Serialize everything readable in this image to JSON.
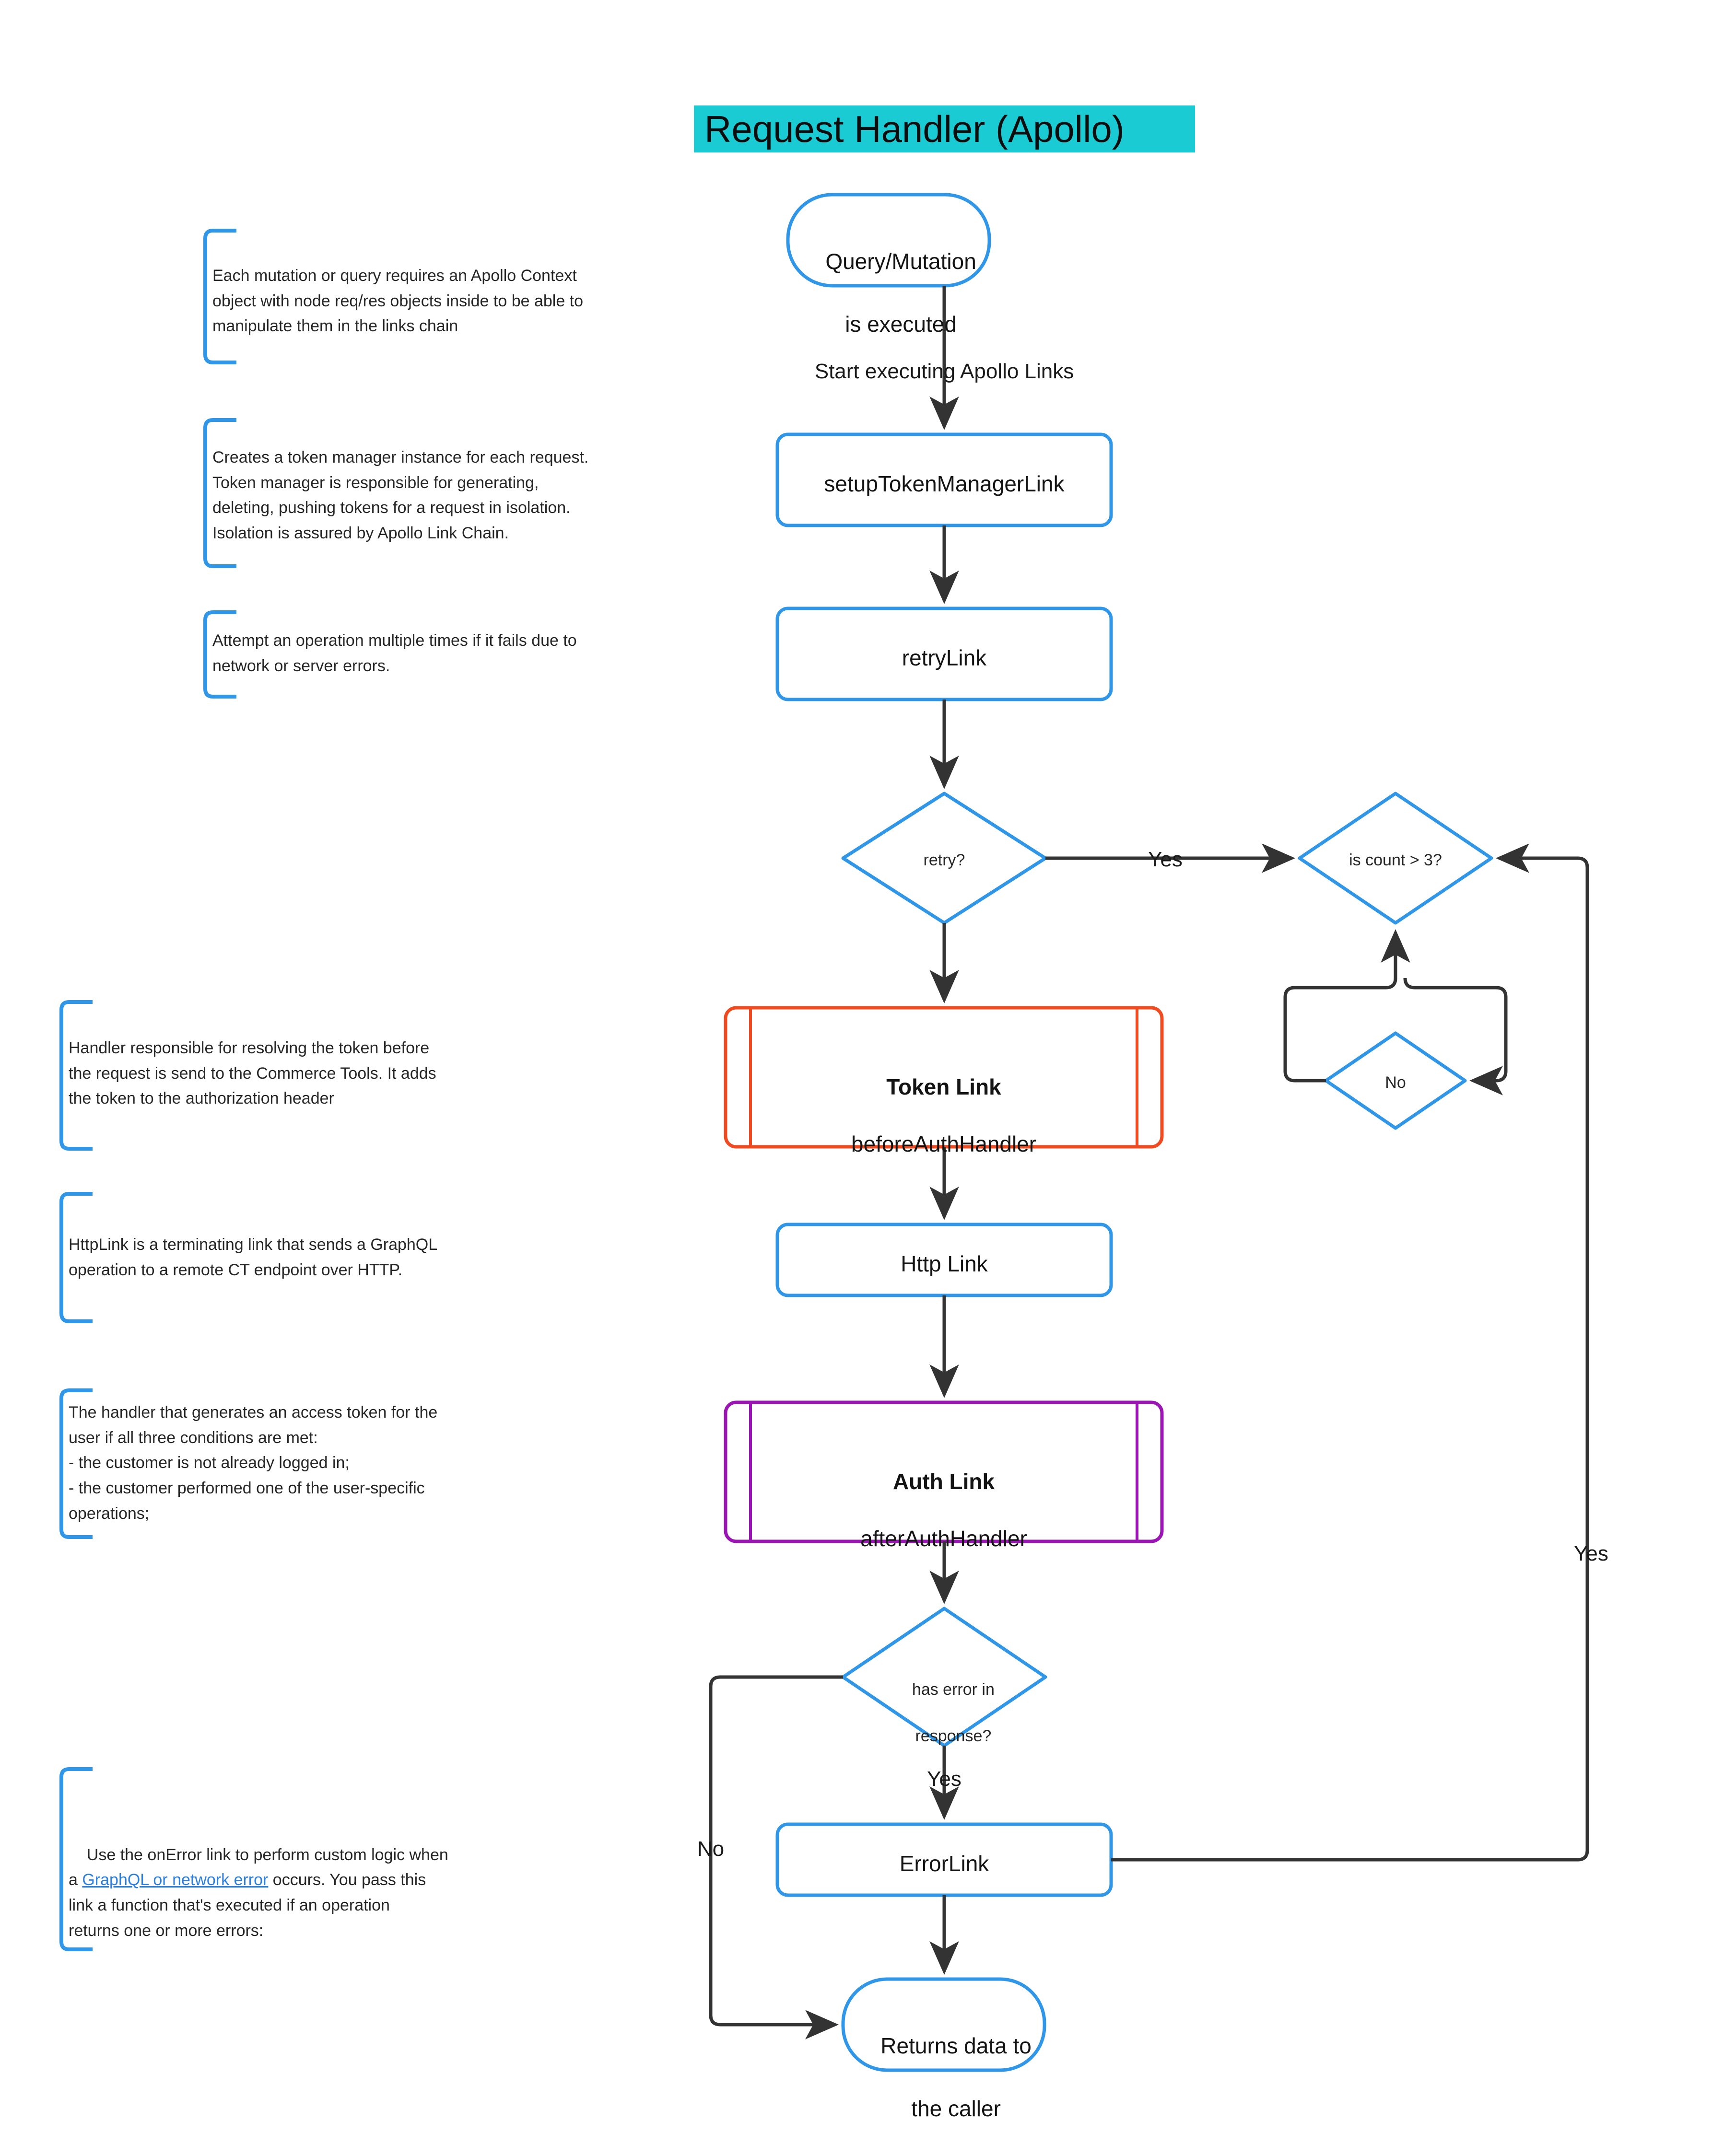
{
  "title": {
    "text": "Request Handler (Apollo)",
    "background": "#1bcbd4"
  },
  "colors": {
    "flow_blue": "#2f96e8",
    "token_red": "#f04a21",
    "auth_purple": "#9b15b5",
    "arrow_black": "#333333",
    "link_blue": "#2b7fe0",
    "title_bg": "#1bcbd4"
  },
  "nodes": {
    "start": {
      "line1": "Query/Mutation",
      "line2": "is executed",
      "shape": "terminator",
      "color": "#2f96e8"
    },
    "setup_token_manager": {
      "label": "setupTokenManagerLink",
      "shape": "process",
      "color": "#2f96e8"
    },
    "retry_link": {
      "label": "retryLink",
      "shape": "process",
      "color": "#2f96e8"
    },
    "retry_decision": {
      "label": "retry?",
      "shape": "decision",
      "color": "#2f96e8"
    },
    "count_decision": {
      "label": "is count > 3?",
      "shape": "decision",
      "color": "#2f96e8"
    },
    "no_decision": {
      "label": "No",
      "shape": "decision",
      "color": "#2f96e8"
    },
    "token_link": {
      "title": "Token Link",
      "subtitle": "beforeAuthHandler",
      "shape": "subroutine",
      "color": "#f04a21"
    },
    "http_link": {
      "label": "Http Link",
      "shape": "process",
      "color": "#2f96e8"
    },
    "auth_link": {
      "title": "Auth Link",
      "subtitle": "afterAuthHandler",
      "shape": "subroutine",
      "color": "#9b15b5"
    },
    "error_decision": {
      "line1": "has error in",
      "line2": "response?",
      "shape": "decision",
      "color": "#2f96e8"
    },
    "error_link": {
      "label": "ErrorLink",
      "shape": "process",
      "color": "#2f96e8"
    },
    "returns": {
      "line1": "Returns data to",
      "line2": "the caller",
      "shape": "terminator",
      "color": "#2f96e8"
    }
  },
  "edges": {
    "start_to_setup": "Start executing Apollo Links",
    "retry_yes": "Yes",
    "error_yes": "Yes",
    "error_no": "No",
    "errorlink_back_yes": "Yes"
  },
  "notes": [
    {
      "id": "note-context",
      "text": "Each mutation or query requires an Apollo Context\nobject with node req/res objects inside to be able to\nmanipulate them in the links chain"
    },
    {
      "id": "note-token-manager",
      "text": "Creates a token manager instance for each request.\nToken manager is responsible for generating,\ndeleting, pushing tokens for a request in isolation.\nIsolation is assured by Apollo Link Chain."
    },
    {
      "id": "note-retry",
      "text": "Attempt an operation multiple times if it fails due to\nnetwork or server errors."
    },
    {
      "id": "note-token-link",
      "text": "Handler responsible for resolving the token before\nthe request is send to the Commerce Tools. It adds\nthe token to the authorization header"
    },
    {
      "id": "note-http-link",
      "text": "HttpLink is a terminating link that sends a GraphQL\noperation to a remote CT endpoint over HTTP."
    },
    {
      "id": "note-auth-link",
      "text": "The handler that generates an access token for the\nuser if all three conditions are met:\n- the customer is not already logged in;\n- the customer performed one of the user-specific\noperations;"
    },
    {
      "id": "note-error-link",
      "prefix": "Use the onError link to perform custom logic when\na ",
      "link": "GraphQL or network error",
      "suffix": " occurs. You pass this\nlink a function that's executed if an operation\nreturns one or more errors:"
    }
  ]
}
